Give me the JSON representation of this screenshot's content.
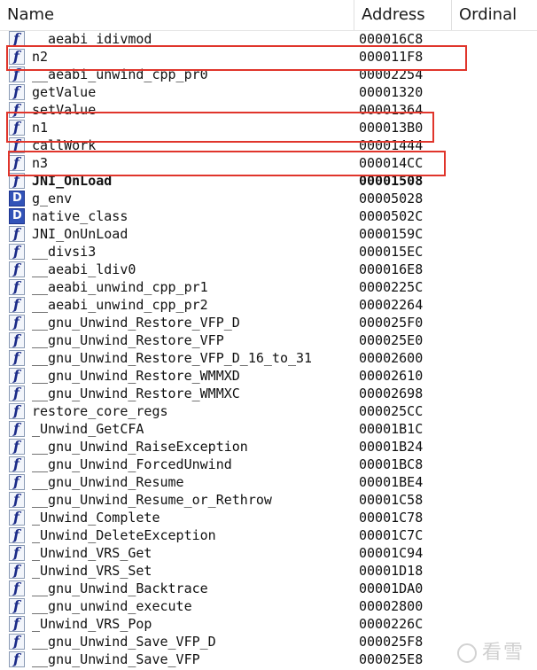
{
  "columns": {
    "name": "Name",
    "address": "Address",
    "ordinal": "Ordinal"
  },
  "rows": [
    {
      "icon": "function-icon",
      "name": "__aeabi_idivmod",
      "address": "000016C8"
    },
    {
      "icon": "function-icon",
      "name": "n2",
      "address": "000011F8"
    },
    {
      "icon": "function-icon",
      "name": "__aeabi_unwind_cpp_pr0",
      "address": "00002254"
    },
    {
      "icon": "function-icon",
      "name": "getValue",
      "address": "00001320"
    },
    {
      "icon": "function-icon",
      "name": "setValue",
      "address": "00001364"
    },
    {
      "icon": "function-icon",
      "name": "n1",
      "address": "000013B0"
    },
    {
      "icon": "function-icon",
      "name": "callWork",
      "address": "00001444"
    },
    {
      "icon": "function-icon",
      "name": "n3",
      "address": "000014CC"
    },
    {
      "icon": "function-icon",
      "name": "JNI_OnLoad",
      "address": "00001508",
      "bold": true
    },
    {
      "icon": "data-icon",
      "name": "g_env",
      "address": "00005028"
    },
    {
      "icon": "data-icon",
      "name": "native_class",
      "address": "0000502C"
    },
    {
      "icon": "function-icon",
      "name": "JNI_OnUnLoad",
      "address": "0000159C"
    },
    {
      "icon": "function-icon",
      "name": "__divsi3",
      "address": "000015EC"
    },
    {
      "icon": "function-icon",
      "name": "__aeabi_ldiv0",
      "address": "000016E8"
    },
    {
      "icon": "function-icon",
      "name": "__aeabi_unwind_cpp_pr1",
      "address": "0000225C"
    },
    {
      "icon": "function-icon",
      "name": "__aeabi_unwind_cpp_pr2",
      "address": "00002264"
    },
    {
      "icon": "function-icon",
      "name": "__gnu_Unwind_Restore_VFP_D",
      "address": "000025F0"
    },
    {
      "icon": "function-icon",
      "name": "__gnu_Unwind_Restore_VFP",
      "address": "000025E0"
    },
    {
      "icon": "function-icon",
      "name": "__gnu_Unwind_Restore_VFP_D_16_to_31",
      "address": "00002600"
    },
    {
      "icon": "function-icon",
      "name": "__gnu_Unwind_Restore_WMMXD",
      "address": "00002610"
    },
    {
      "icon": "function-icon",
      "name": "__gnu_Unwind_Restore_WMMXC",
      "address": "00002698"
    },
    {
      "icon": "function-icon",
      "name": "restore_core_regs",
      "address": "000025CC"
    },
    {
      "icon": "function-icon",
      "name": "_Unwind_GetCFA",
      "address": "00001B1C"
    },
    {
      "icon": "function-icon",
      "name": "__gnu_Unwind_RaiseException",
      "address": "00001B24"
    },
    {
      "icon": "function-icon",
      "name": "__gnu_Unwind_ForcedUnwind",
      "address": "00001BC8"
    },
    {
      "icon": "function-icon",
      "name": "__gnu_Unwind_Resume",
      "address": "00001BE4"
    },
    {
      "icon": "function-icon",
      "name": "__gnu_Unwind_Resume_or_Rethrow",
      "address": "00001C58"
    },
    {
      "icon": "function-icon",
      "name": "_Unwind_Complete",
      "address": "00001C78"
    },
    {
      "icon": "function-icon",
      "name": "_Unwind_DeleteException",
      "address": "00001C7C"
    },
    {
      "icon": "function-icon",
      "name": "_Unwind_VRS_Get",
      "address": "00001C94"
    },
    {
      "icon": "function-icon",
      "name": "_Unwind_VRS_Set",
      "address": "00001D18"
    },
    {
      "icon": "function-icon",
      "name": "__gnu_Unwind_Backtrace",
      "address": "00001DA0"
    },
    {
      "icon": "function-icon",
      "name": "__gnu_unwind_execute",
      "address": "00002800"
    },
    {
      "icon": "function-icon",
      "name": "_Unwind_VRS_Pop",
      "address": "0000226C"
    },
    {
      "icon": "function-icon",
      "name": "__gnu_Unwind_Save_VFP_D",
      "address": "000025F8"
    },
    {
      "icon": "function-icon",
      "name": "__gnu_Unwind_Save_VFP",
      "address": "000025E8"
    }
  ],
  "highlight_color": "#e0352b",
  "watermark": {
    "text": "看雪"
  }
}
